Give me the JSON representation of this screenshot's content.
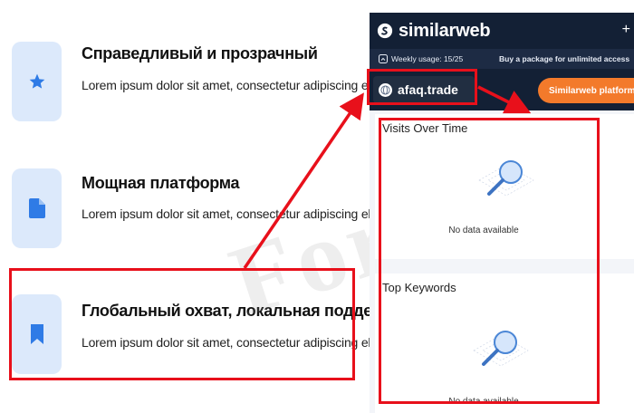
{
  "features": [
    {
      "title": "Справедливый и прозрачный",
      "description": "Lorem ipsum dolor sit amet, consectetur adipiscing elit.",
      "icon": "star-icon"
    },
    {
      "title": "Мощная платформа",
      "description": "Lorem ipsum dolor sit amet, consectetur adipiscing elit.",
      "icon": "document-icon"
    },
    {
      "title": "Глобальный охват, локальная поддержка",
      "description": "Lorem ipsum dolor sit amet, consectetur adipiscing elit.",
      "icon": "bookmark-icon"
    }
  ],
  "similarweb": {
    "logo_text": "similarweb",
    "close_glyph": "+",
    "weekly_usage": "Weekly usage: 15/25",
    "buy_package": "Buy a package for unlimited access",
    "domain": "afaq.trade",
    "cta_label": "Similarweb platform",
    "cards": [
      {
        "title": "Visits Over Time",
        "empty_text": "No data available"
      },
      {
        "title": "Top Keywords",
        "empty_text": "No data available"
      }
    ]
  },
  "watermark": "Forteck",
  "colors": {
    "accent_blue": "#2f7be6",
    "icon_bg": "#dce9fb",
    "highlight_red": "#e8101b",
    "sw_navy": "#132035",
    "sw_orange": "#f37a2b"
  }
}
